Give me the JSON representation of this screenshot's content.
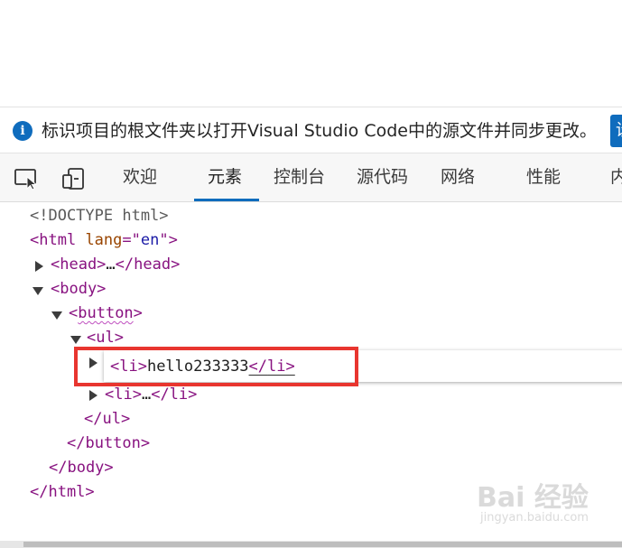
{
  "infobar": {
    "icon": "info-icon",
    "icon_glyph": "i",
    "message": "标识项目的根文件夹以打开Visual Studio Code中的源文件并同步更改。",
    "button_label": "设"
  },
  "toolbar": {
    "inspect_icon": "inspect-element-icon",
    "device_icon": "device-emulation-icon"
  },
  "tabs": [
    {
      "label": "欢迎",
      "active": false
    },
    {
      "label": "元素",
      "active": true
    },
    {
      "label": "控制台",
      "active": false
    },
    {
      "label": "源代码",
      "active": false
    },
    {
      "label": "网络",
      "active": false
    },
    {
      "label": "性能",
      "active": false
    },
    {
      "label": "内",
      "active": false
    }
  ],
  "dom": {
    "doctype": "<!DOCTYPE html>",
    "html_open_tag": "<html",
    "html_attr": "lang",
    "html_attr_eq": "=\"",
    "html_attr_val": "en",
    "html_attr_close": "\">",
    "head": "<head>",
    "ellipsis": "…",
    "head_close": "</head>",
    "body": "<body>",
    "button": "button",
    "lt": "<",
    "gt": ">",
    "ul": "<ul>",
    "li_open": "<li>",
    "li_text": "hello233333",
    "li_close_lt": "</",
    "li_close_name": "li",
    "li_close_gt": ">",
    "li2_open": "<li>",
    "li2_close": "</li>",
    "ul_close": "</ul>",
    "button_close": "</button>",
    "body_close": "</body>",
    "html_close": "</html>"
  },
  "watermark": {
    "main": "Bai 经验",
    "sub": "jingyan.baidu.com"
  }
}
